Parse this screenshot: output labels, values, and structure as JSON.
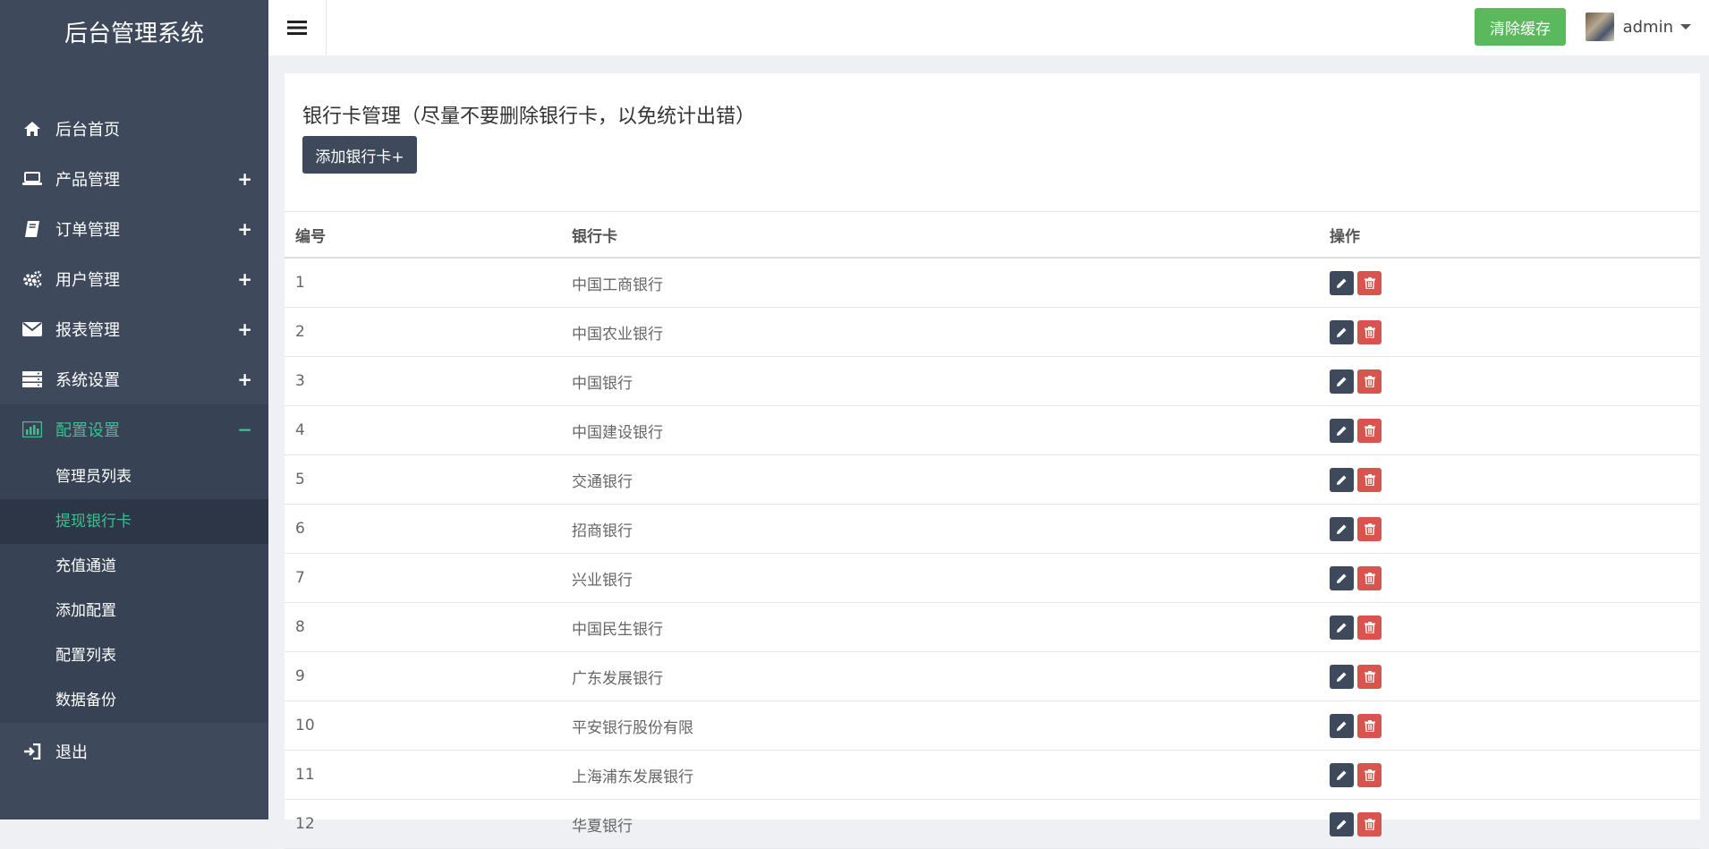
{
  "brand": "后台管理系统",
  "menu": [
    {
      "label": "后台首页",
      "icon": "home-icon",
      "expand": ""
    },
    {
      "label": "产品管理",
      "icon": "laptop-icon",
      "expand": "+"
    },
    {
      "label": "订单管理",
      "icon": "book-icon",
      "expand": "+"
    },
    {
      "label": "用户管理",
      "icon": "cogs-icon",
      "expand": "+"
    },
    {
      "label": "报表管理",
      "icon": "envelope-icon",
      "expand": "+"
    },
    {
      "label": "系统设置",
      "icon": "server-icon",
      "expand": "+"
    },
    {
      "label": "配置设置",
      "icon": "bar-chart-icon",
      "expand": "−"
    }
  ],
  "submenu": [
    {
      "label": "管理员列表"
    },
    {
      "label": "提现银行卡"
    },
    {
      "label": "充值通道"
    },
    {
      "label": "添加配置"
    },
    {
      "label": "配置列表"
    },
    {
      "label": "数据备份"
    }
  ],
  "logout": "退出",
  "topbar": {
    "clear_cache": "清除缓存",
    "username": "admin"
  },
  "page": {
    "title": "银行卡管理（尽量不要删除银行卡，以免统计出错）",
    "add_button": "添加银行卡+"
  },
  "table": {
    "headers": [
      "编号",
      "银行卡",
      "操作"
    ],
    "rows": [
      {
        "id": "1",
        "name": "中国工商银行"
      },
      {
        "id": "2",
        "name": "中国农业银行"
      },
      {
        "id": "3",
        "name": "中国银行"
      },
      {
        "id": "4",
        "name": "中国建设银行"
      },
      {
        "id": "5",
        "name": "交通银行"
      },
      {
        "id": "6",
        "name": "招商银行"
      },
      {
        "id": "7",
        "name": "兴业银行"
      },
      {
        "id": "8",
        "name": "中国民生银行"
      },
      {
        "id": "9",
        "name": "广东发展银行"
      },
      {
        "id": "10",
        "name": "平安银行股份有限"
      },
      {
        "id": "11",
        "name": "上海浦东发展银行"
      },
      {
        "id": "12",
        "name": "华夏银行"
      }
    ]
  },
  "colors": {
    "sidebar": "#3e4a5c",
    "accent": "#3dbf8f",
    "success": "#5cb85c",
    "danger": "#d9534f"
  }
}
